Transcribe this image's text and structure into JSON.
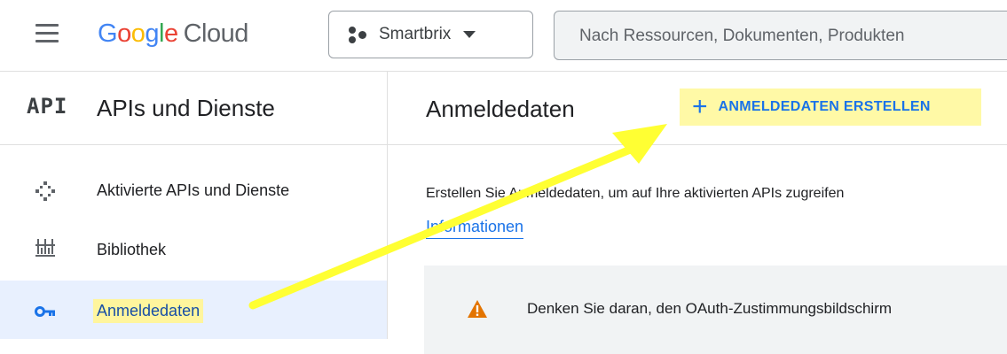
{
  "topbar": {
    "logo_letters": [
      "G",
      "o",
      "o",
      "g",
      "l",
      "e"
    ],
    "logo_cloud": "Cloud",
    "project_name": "Smartbrix",
    "search_placeholder": "Nach Ressourcen, Dokumenten, Produkten"
  },
  "sidebar": {
    "api_mark": "API",
    "title": "APIs und Dienste",
    "items": [
      {
        "label": "Aktivierte APIs und Dienste",
        "icon": "api-diamond-icon"
      },
      {
        "label": "Bibliothek",
        "icon": "library-icon"
      },
      {
        "label": "Anmeldedaten",
        "icon": "key-icon",
        "active": true
      }
    ]
  },
  "main": {
    "title": "Anmeldedaten",
    "create_button": {
      "icon": "plus-icon",
      "label": "ANMELDEDATEN ERSTELLEN"
    },
    "description": "Erstellen Sie Anmeldedaten, um auf Ihre aktivierten APIs zugreifen",
    "more_link": "Informationen",
    "warning": {
      "icon": "warning-icon",
      "text": "Denken Sie daran, den OAuth-Zustimmungsbildschirm"
    }
  },
  "colors": {
    "accent": "#1a73e8",
    "highlight": "#fff59d",
    "annotation_arrow": "#ffff33",
    "warning": "#e37400",
    "active_bg": "#e8f0fe"
  }
}
